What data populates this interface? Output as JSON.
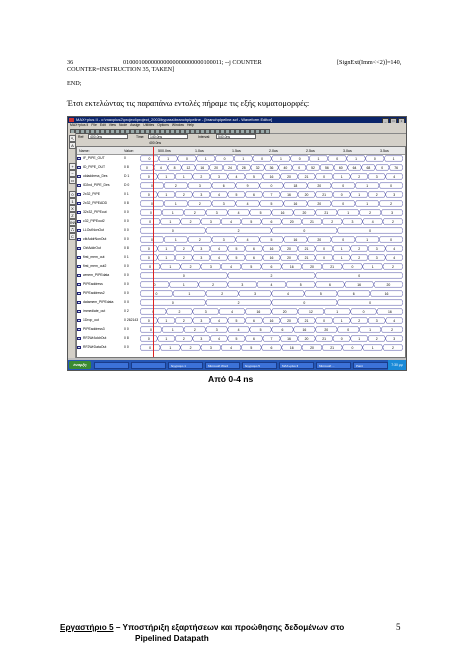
{
  "code": {
    "line1_num": "36",
    "line1_bits": "01000100000000000000000000100011; --j COUNTER",
    "line1_right": "[SignExt(Imm<<2)]=140,",
    "line2": "COUNTER=INSTRUCTION 35, TAKEN]",
    "end": "END;"
  },
  "intro": "Έτσι εκτελώντας τις παραπάνω εντολές πήραμε τις εξής κυματομορφές:",
  "screenshot": {
    "title": "MAX+plus II - c:\\maxplus2\\project\\project_2003\\bypass\\branchpipeline - [branchpipeline.scf - Waveform Editor]",
    "menus": [
      "MAX+plus II",
      "File",
      "Edit",
      "View",
      "Node",
      "Assign",
      "Utilities",
      "Options",
      "Window",
      "Help"
    ],
    "ref_label": "Ref:",
    "ref_value": "400.0ns",
    "time_label": "Time:",
    "time_value": "140.0ns",
    "interval_label": "Interval:",
    "interval_value": "540.0ns",
    "cursor_label": "400.0ns",
    "header": {
      "name": "Name:",
      "value": "Value:"
    },
    "time_ticks": [
      "500.0ns",
      "1.0us",
      "1.5us",
      "2.0us",
      "2.5us",
      "3.0us",
      "3.5us"
    ],
    "signals": [
      {
        "name": "IF_PIPE_OUT",
        "value": "0",
        "segments": [
          "0",
          "1",
          "0",
          "1",
          "0",
          "1",
          "0",
          "1",
          "0",
          "1",
          "0",
          "1",
          "0",
          "1"
        ]
      },
      {
        "name": "ID_PIPE_OUT",
        "value": "0 8",
        "segments": [
          "0",
          "4",
          "8",
          "12",
          "16",
          "20",
          "24",
          "28",
          "32",
          "36",
          "40",
          "0",
          "52",
          "56",
          "60",
          "64",
          "68",
          "0",
          "76"
        ]
      },
      {
        "name": "oldaddress_Des",
        "value": "D 1",
        "segments": [
          "0",
          "1",
          "1",
          "2",
          "3",
          "4",
          "5",
          "16",
          "20",
          "21",
          "0",
          "1",
          "2",
          "3",
          "4"
        ]
      },
      {
        "name": "ID2nd_PIPE_Des",
        "value": "D 0",
        "segments": [
          "0",
          "2",
          "3",
          "6",
          "9",
          "0",
          "18",
          "20",
          "0",
          "1",
          "0"
        ]
      },
      {
        "name": "2x32_PIPE",
        "value": "0 1",
        "segments": [
          "0",
          "1",
          "2",
          "3",
          "4",
          "5",
          "6",
          "7",
          "16",
          "20",
          "21",
          "0",
          "1",
          "2",
          "3"
        ]
      },
      {
        "name": "2x32_PIPEADD",
        "value": "0 8",
        "segments": [
          "0",
          "1",
          "2",
          "3",
          "4",
          "5",
          "16",
          "20",
          "0",
          "1",
          "2"
        ]
      },
      {
        "name": "32x32_PIPEout",
        "value": "0 0",
        "segments": [
          "0",
          "1",
          "2",
          "3",
          "4",
          "5",
          "16",
          "20",
          "21",
          "1",
          "2",
          "3"
        ]
      },
      {
        "name": "c32_PIPEout2",
        "value": "0 0",
        "segments": [
          "0",
          "1",
          "2",
          "3",
          "4",
          "5",
          "6",
          "20",
          "21",
          "2",
          "3",
          "4",
          "2"
        ]
      },
      {
        "name": "LLOutNonOut",
        "value": "0 0",
        "segments": [
          "0",
          "2",
          "0",
          "0"
        ]
      },
      {
        "name": "ctlrAddrNonOut",
        "value": "0 0",
        "segments": [
          "0",
          "1",
          "2",
          "3",
          "4",
          "5",
          "16",
          "20",
          "0",
          "1",
          "0"
        ]
      },
      {
        "name": "CtrlAddrOut",
        "value": "0 8",
        "segments": [
          "0",
          "1",
          "2",
          "3",
          "4",
          "5",
          "6",
          "16",
          "20",
          "21",
          "0",
          "1",
          "2",
          "3",
          "4"
        ]
      },
      {
        "name": "first_mem_out",
        "value": "0 1",
        "segments": [
          "0",
          "1",
          "2",
          "3",
          "4",
          "5",
          "6",
          "16",
          "20",
          "21",
          "0",
          "1",
          "2",
          "3",
          "4"
        ]
      },
      {
        "name": "first_mem_out2",
        "value": "0 0",
        "segments": [
          "0",
          "1",
          "2",
          "3",
          "4",
          "5",
          "6",
          "16",
          "20",
          "21",
          "0",
          "1",
          "2"
        ]
      },
      {
        "name": "wmem_PIPEdata",
        "value": "0 0",
        "segments": [
          "0",
          "2",
          "0"
        ]
      },
      {
        "name": "PIPEaddress",
        "value": "0 0",
        "segments": [
          "0",
          "1",
          "2",
          "3",
          "4",
          "5",
          "6",
          "16",
          "20"
        ]
      },
      {
        "name": "PIPEaddress2",
        "value": "0 0",
        "segments": [
          "0",
          "1",
          "2",
          "3",
          "4",
          "5",
          "6",
          "16"
        ]
      },
      {
        "name": "datamem_PIPEdata",
        "value": "0 X",
        "segments": [
          "0",
          "2",
          "0",
          "0"
        ]
      },
      {
        "name": "immediate_out",
        "value": "0 2",
        "segments": [
          "0",
          "2",
          "3",
          "4",
          "16",
          "20",
          "12",
          "1",
          "0",
          "16"
        ]
      },
      {
        "name": "1Drop_out",
        "value": "0 262143",
        "segments": [
          "0",
          "1",
          "2",
          "3",
          "4",
          "5",
          "6",
          "16",
          "20",
          "21",
          "0",
          "1",
          "2",
          "3",
          "4"
        ]
      },
      {
        "name": "PIPEaddress3",
        "value": "0 0",
        "segments": [
          "0",
          "1",
          "2",
          "3",
          "4",
          "5",
          "6",
          "16",
          "20",
          "0",
          "1",
          "2"
        ]
      },
      {
        "name": "RF2WrAddrOut",
        "value": "0 8",
        "segments": [
          "0",
          "1",
          "2",
          "3",
          "4",
          "5",
          "6",
          "7",
          "16",
          "20",
          "21",
          "0",
          "1",
          "2",
          "3"
        ]
      },
      {
        "name": "RF2WrDataOut",
        "value": "0 0",
        "segments": [
          "0",
          "1",
          "2",
          "3",
          "4",
          "5",
          "6",
          "16",
          "20",
          "21",
          "0",
          "1",
          "2"
        ]
      }
    ],
    "taskbar": {
      "start": "έναρξη",
      "tasks": [
        "",
        "",
        "Έγγραφο 1",
        "Microsoft Word",
        "Έγγραφο 5",
        "MAX+plus II",
        "Microsoft ...",
        "Paint"
      ],
      "clock": "7:30 μμ"
    }
  },
  "caption": "Από 0-4 ns",
  "footer": {
    "lab": "Εργαστήριο 5",
    "title_part": " – Υποστήριξη εξαρτήσεων και προώθησης δεδομένων στο",
    "title_line2": "Pipelined  Datapath",
    "page": "5"
  }
}
